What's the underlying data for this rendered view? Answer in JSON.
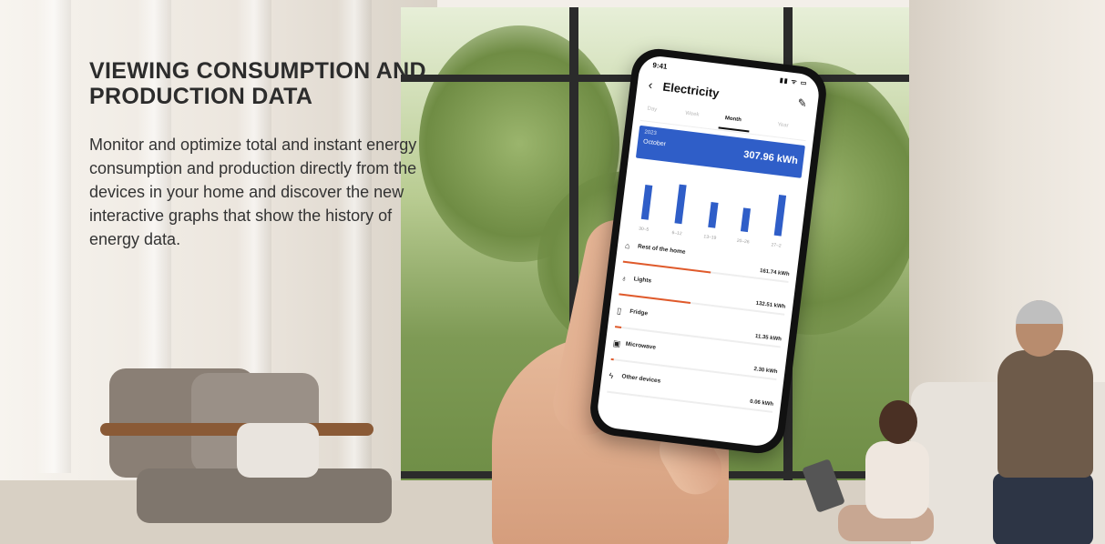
{
  "headline": "VIEWING CONSUMPTION AND PRODUCTION DATA",
  "body_text": "Monitor and optimize total and instant energy consumption and production directly from the devices in your home and discover the new interactive graphs that show the history of energy data.",
  "phone": {
    "status_time": "9:41",
    "status_icons": "▮▮ ᯤ ▭",
    "app_title": "Electricity",
    "back_icon": "chevron-left-icon",
    "edit_icon": "pencil-icon",
    "tabs": [
      {
        "label": "Day",
        "active": false
      },
      {
        "label": "Week",
        "active": false
      },
      {
        "label": "Month",
        "active": true
      },
      {
        "label": "Year",
        "active": false
      }
    ],
    "summary": {
      "year": "2023",
      "month": "October",
      "value": "307.96 kWh"
    },
    "chart_data": {
      "type": "bar",
      "categories": [
        "30–5",
        "6–12",
        "13–19",
        "20–26",
        "27–2"
      ],
      "values": [
        0.75,
        0.85,
        0.55,
        0.52,
        0.9
      ]
    },
    "devices": [
      {
        "name": "Rest of the home",
        "value": "161.74 kWh",
        "share": 0.53,
        "icon": "⌂"
      },
      {
        "name": "Lights",
        "value": "132.51 kWh",
        "share": 0.43,
        "icon": "♁"
      },
      {
        "name": "Fridge",
        "value": "11.35 kWh",
        "share": 0.04,
        "icon": "▯"
      },
      {
        "name": "Microwave",
        "value": "2.30 kWh",
        "share": 0.01,
        "icon": "▣"
      },
      {
        "name": "Other devices",
        "value": "0.06 kWh",
        "share": 0.0,
        "icon": "ϟ"
      }
    ]
  }
}
